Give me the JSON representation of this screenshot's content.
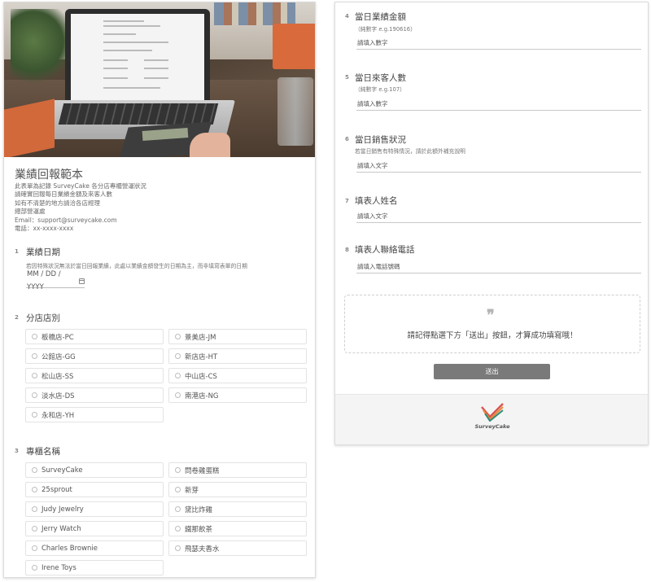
{
  "form": {
    "title": "業績回報範本",
    "description": [
      "此表單為記錄 SurveyCake 各分店專櫃營運狀況",
      "請確實回報每日業績金額及來客人數",
      "如有不清楚的地方請洽各店經理",
      "總部營運處",
      "Email：support@surveycake.com",
      "電話：xx-xxxx-xxxx"
    ]
  },
  "q1": {
    "num": "1",
    "title": "業績日期",
    "sub": "若因特殊狀況無法於當日回報業績，此處以業績金額發生的日期為主，而非填寫表單的日期",
    "date_placeholder": "MM / DD / YYYY",
    "icon": "calendar-icon"
  },
  "q2": {
    "num": "2",
    "title": "分店店別",
    "options": [
      "板橋店-PC",
      "景美店-JM",
      "公館店-GG",
      "新店店-HT",
      "松山店-SS",
      "中山店-CS",
      "淡水店-DS",
      "南港店-NG",
      "永和店-YH"
    ]
  },
  "q3": {
    "num": "3",
    "title": "專櫃名稱",
    "options": [
      "SurveyCake",
      "問卷雞蛋糕",
      "25sprout",
      "新芽",
      "Judy Jewelry",
      "黛比炸雞",
      "Jerry Watch",
      "鐵那飲茶",
      "Charles Brownie",
      "飛瑟夫香水",
      "Irene Toys"
    ]
  },
  "q4": {
    "num": "4",
    "title": "當日業績金額",
    "sub": "（純數字 e.g.190616）",
    "placeholder": "請填入數字"
  },
  "q5": {
    "num": "5",
    "title": "當日來客人數",
    "sub": "（純數字 e.g.107）",
    "placeholder": "請填入數字"
  },
  "q6": {
    "num": "6",
    "title": "當日銷售狀況",
    "sub": "若當日銷售有特殊情況，請於此額外補充說明",
    "placeholder": "請填入文字"
  },
  "q7": {
    "num": "7",
    "title": "填表人姓名",
    "placeholder": "請填入文字"
  },
  "q8": {
    "num": "8",
    "title": "填表人聯絡電話",
    "placeholder": "請填入電話號碼"
  },
  "note": {
    "icon": "quote-icon",
    "text": "請記得點選下方「送出」按鈕，才算成功填寫哦！"
  },
  "submit_label": "送出",
  "footer": {
    "logo_text": "SurveyCake"
  },
  "colors": {
    "logo_red": "#d9534f",
    "logo_orange": "#e8883a",
    "logo_teal": "#2f8a7a",
    "button": "#7a7a7a"
  }
}
